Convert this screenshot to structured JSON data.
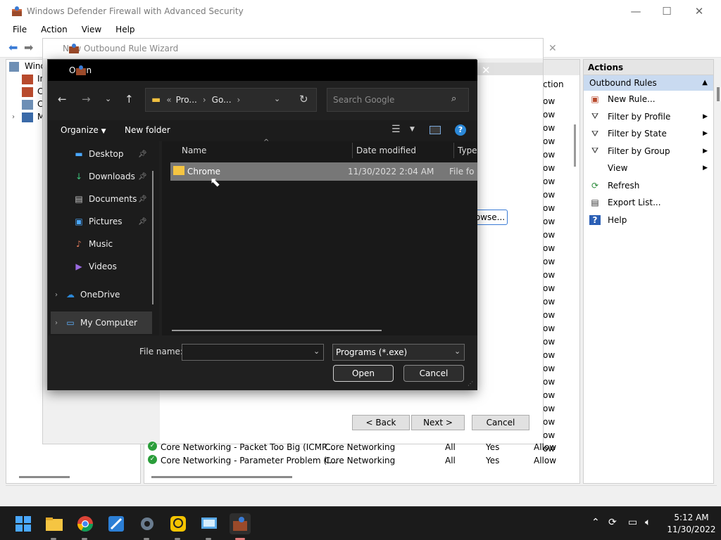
{
  "mmc": {
    "title": "Windows Defender Firewall with Advanced Security",
    "menu": [
      "File",
      "Action",
      "View",
      "Help"
    ],
    "tree_label": "Windo",
    "tree_partial": [
      "In",
      "C",
      "C",
      "M"
    ],
    "col_partial": "ction",
    "row_partial": "ow",
    "rows": [
      {
        "name": "Core Networking - Packet Too Big (ICMP...",
        "group": "Core Networking",
        "profile": "All",
        "enabled": "Yes",
        "action": "Allow"
      },
      {
        "name": "Core Networking - Parameter Problem (I...",
        "group": "Core Networking",
        "profile": "All",
        "enabled": "Yes",
        "action": "Allow"
      }
    ],
    "actions": {
      "header": "Actions",
      "section": "Outbound Rules",
      "items": [
        {
          "label": "New Rule...",
          "icon": "new-rule-icon",
          "arrow": false
        },
        {
          "label": "Filter by Profile",
          "icon": "filter-icon",
          "arrow": true
        },
        {
          "label": "Filter by State",
          "icon": "filter-icon",
          "arrow": true
        },
        {
          "label": "Filter by Group",
          "icon": "filter-icon",
          "arrow": true
        },
        {
          "label": "View",
          "icon": "",
          "arrow": true
        },
        {
          "label": "Refresh",
          "icon": "refresh-icon",
          "arrow": false
        },
        {
          "label": "Export List...",
          "icon": "export-icon",
          "arrow": false
        },
        {
          "label": "Help",
          "icon": "help-icon",
          "arrow": false
        }
      ]
    }
  },
  "wizard": {
    "title": "New Outbound Rule Wizard",
    "browse_label": "owse...",
    "back_label": "< Back",
    "next_label": "Next >",
    "cancel_label": "Cancel"
  },
  "dialog": {
    "title": "Open",
    "breadcrumb": [
      "Pro...",
      "Go..."
    ],
    "breadcrumb_prefix": "«",
    "search_placeholder": "Search Google",
    "organize_label": "Organize",
    "new_folder_label": "New folder",
    "nav_items": [
      {
        "label": "Desktop",
        "pinned": true
      },
      {
        "label": "Downloads",
        "pinned": true
      },
      {
        "label": "Documents",
        "pinned": true
      },
      {
        "label": "Pictures",
        "pinned": true
      },
      {
        "label": "Music",
        "pinned": false
      },
      {
        "label": "Videos",
        "pinned": false
      }
    ],
    "onedrive_label": "OneDrive",
    "mycomputer_label": "My Computer",
    "columns": {
      "name": "Name",
      "date": "Date modified",
      "type": "Type"
    },
    "files": [
      {
        "name": "Chrome",
        "date": "11/30/2022 2:04 AM",
        "type": "File fo"
      }
    ],
    "filename_label": "File name:",
    "filename_value": "",
    "filetype_value": "Programs (*.exe)",
    "open_label": "Open",
    "cancel_label": "Cancel"
  },
  "taskbar": {
    "time": "5:12 AM",
    "date": "11/30/2022"
  }
}
